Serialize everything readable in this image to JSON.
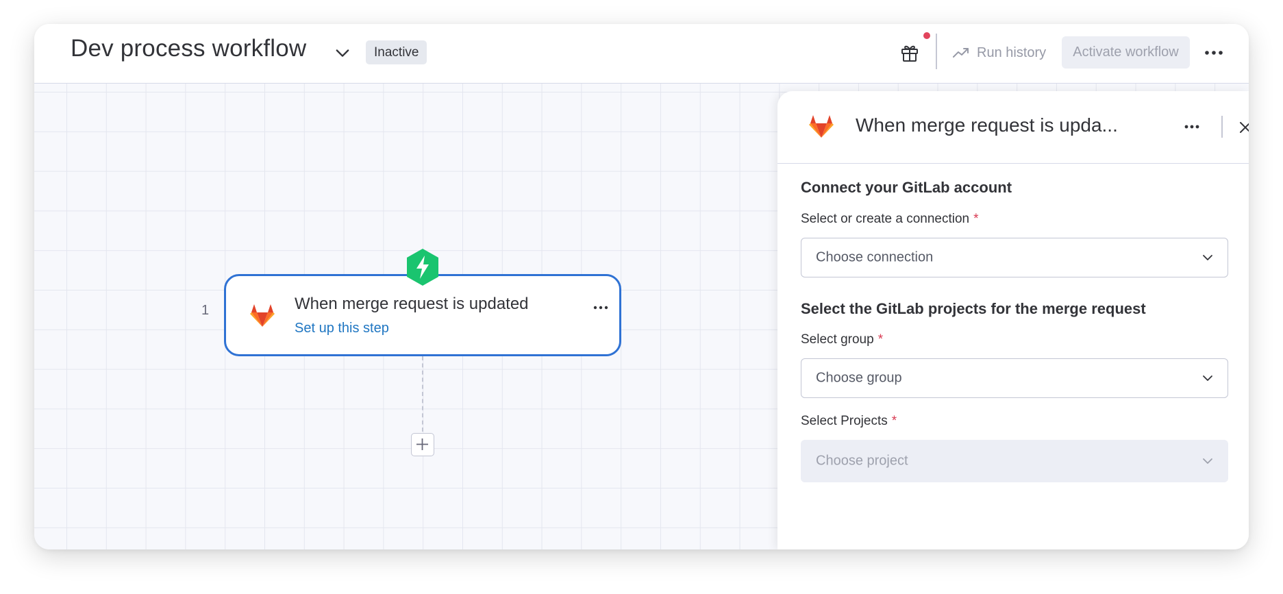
{
  "header": {
    "title": "Dev process workflow",
    "status": "Inactive",
    "run_history": "Run history",
    "activate": "Activate workflow"
  },
  "canvas": {
    "step": {
      "number": "1",
      "title": "When merge request is updated",
      "link": "Set up this step"
    }
  },
  "panel": {
    "title": "When merge request is upda...",
    "connection": {
      "heading": "Connect your GitLab account",
      "label": "Select or create a connection",
      "required": "*",
      "placeholder": "Choose connection"
    },
    "projects": {
      "heading": "Select the GitLab projects for the merge request",
      "group_label": "Select group",
      "group_required": "*",
      "group_placeholder": "Choose group",
      "projects_label": "Select Projects",
      "projects_required": "*",
      "projects_placeholder": "Choose project"
    }
  },
  "colors": {
    "accent": "#2f72d4",
    "trigger": "#1ac46f",
    "gitlab_dark": "#e24329",
    "gitlab_mid": "#fc6d26",
    "gitlab_light": "#fca326",
    "required": "#d83a52",
    "link": "#1f76c2"
  },
  "icons": {
    "title_chevron": "chevron-down-icon",
    "gift": "gift-icon",
    "run_history": "trend-up-icon",
    "more": "more-horizontal-icon",
    "trigger": "lightning-icon",
    "logo": "gitlab-logo-icon",
    "add": "plus-icon",
    "close": "close-icon"
  }
}
